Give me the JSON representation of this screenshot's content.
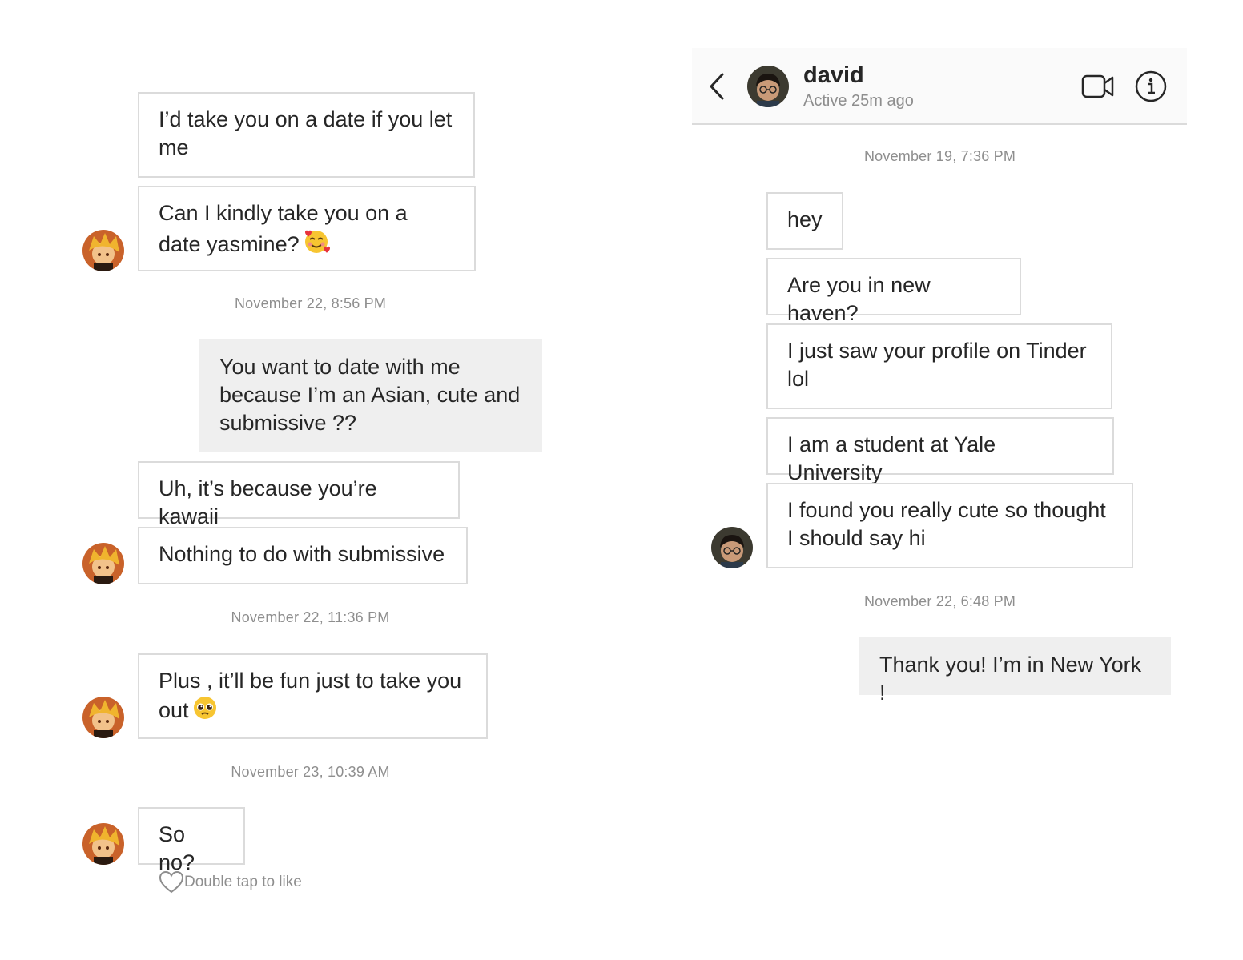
{
  "left_thread": {
    "messages": [
      {
        "text": "I’d take you on a date if you let me"
      },
      {
        "text": "Can I kindly take you on a date yasmine?",
        "emoji": "smiling-face-with-hearts"
      },
      {
        "timestamp": "November 22, 8:56 PM"
      },
      {
        "text": "You want to date with me because I’m an Asian, cute and submissive ??"
      },
      {
        "text": "Uh, it’s because you’re kawaii"
      },
      {
        "text": "Nothing to do with submissive"
      },
      {
        "timestamp": "November 22, 11:36 PM"
      },
      {
        "text": "Plus , it’ll be fun just to take you out",
        "emoji": "pleading-face"
      },
      {
        "timestamp": "November 23, 10:39 AM"
      },
      {
        "text": "So no?"
      }
    ],
    "like_hint": "Double tap to like"
  },
  "right_thread": {
    "header": {
      "name": "david",
      "status": "Active 25m ago",
      "icons": [
        "back-chevron-icon",
        "video-call-icon",
        "info-icon"
      ]
    },
    "messages": [
      {
        "timestamp": "November 19, 7:36 PM"
      },
      {
        "text": "hey"
      },
      {
        "text": "Are you in new haven?"
      },
      {
        "text": "I just saw your profile on Tinder lol"
      },
      {
        "text": "I am a student at Yale University"
      },
      {
        "text": "I found you really cute so thought I should say hi"
      },
      {
        "timestamp": "November 22, 6:48 PM"
      },
      {
        "text": "Thank you! I’m in New York !"
      }
    ]
  },
  "colors": {
    "bubble_border": "#dbdbdb",
    "sent_bubble": "#efefef",
    "timestamp": "#8e8e8e",
    "text": "#262626"
  }
}
